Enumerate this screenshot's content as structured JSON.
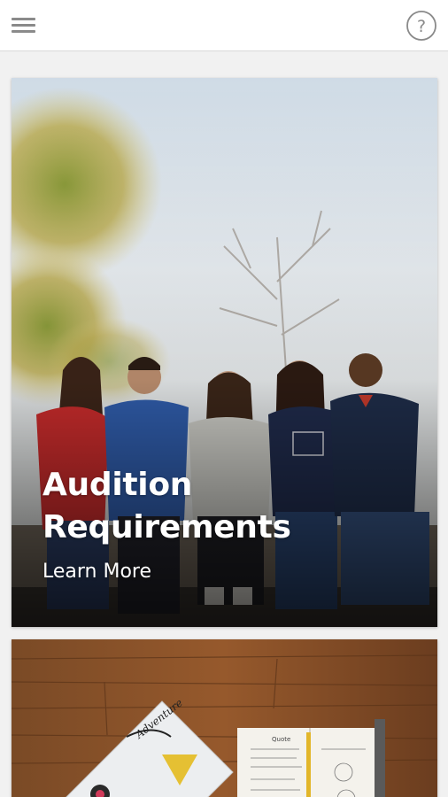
{
  "header": {
    "menu_icon": "hamburger-menu-icon",
    "help_icon": "help-circle-icon",
    "help_glyph": "?"
  },
  "cards": [
    {
      "title_line1": "Audition",
      "title_line2": "Requirements",
      "link_label": "Learn More",
      "image": "group-of-five-people-sitting-outdoors-photo"
    },
    {
      "image": "wooden-desk-with-laptop-stickers-and-notebook-photo",
      "sticker_text": "Adventure",
      "notebook_heading": "Quote"
    }
  ],
  "colors": {
    "header_bg": "#ffffff",
    "page_bg": "#f1f1f1",
    "icon_gray": "#8a8a8a",
    "card_text": "#ffffff"
  }
}
